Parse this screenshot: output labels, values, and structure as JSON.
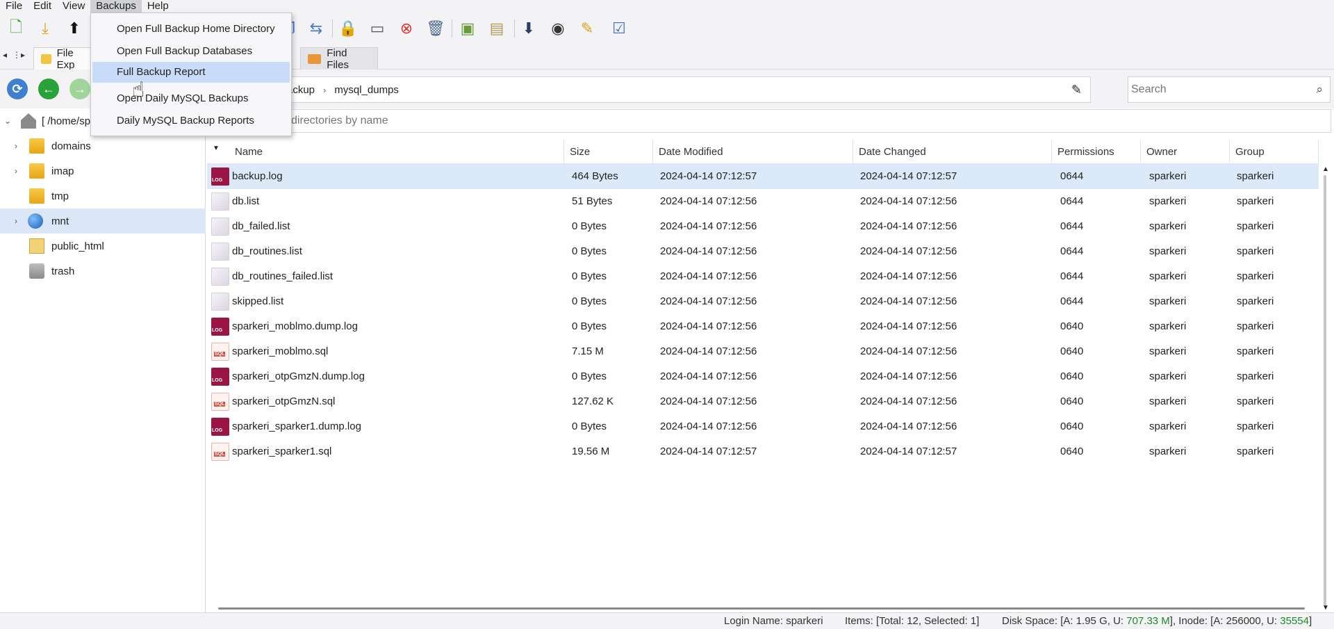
{
  "menubar": {
    "items": [
      "File",
      "Edit",
      "View",
      "Backups",
      "Help"
    ],
    "active": "Backups"
  },
  "tabs": [
    {
      "label": "File Exp",
      "icon": "folder-icon"
    },
    {
      "label": "Find Files",
      "icon": "find-files-icon"
    }
  ],
  "breadcrumb": {
    "first": "ackup",
    "second": "mysql_dumps"
  },
  "search": {
    "placeholder": "Search"
  },
  "filter": {
    "placeholder": "directories by name"
  },
  "tree": {
    "root_label": "[ /home/sp",
    "items": [
      {
        "label": "domains",
        "icon": "folder-icon",
        "expandable": true
      },
      {
        "label": "imap",
        "icon": "folder-icon",
        "expandable": true
      },
      {
        "label": "tmp",
        "icon": "folder-icon",
        "expandable": false
      },
      {
        "label": "mnt",
        "icon": "globe-icon",
        "expandable": true,
        "selected": true
      },
      {
        "label": "public_html",
        "icon": "web-file-icon",
        "expandable": false
      },
      {
        "label": "trash",
        "icon": "trash-icon",
        "expandable": false
      }
    ]
  },
  "table": {
    "columns": [
      "Name",
      "Size",
      "Date Modified",
      "Date Changed",
      "Permissions",
      "Owner",
      "Group"
    ],
    "rows": [
      {
        "type": "log",
        "name": "backup.log",
        "size": "464 Bytes",
        "modified": "2024-04-14 07:12:57",
        "changed": "2024-04-14 07:12:57",
        "perm": "0644",
        "owner": "sparkeri",
        "group": "sparkeri"
      },
      {
        "type": "txt",
        "name": "db.list",
        "size": "51 Bytes",
        "modified": "2024-04-14 07:12:56",
        "changed": "2024-04-14 07:12:56",
        "perm": "0644",
        "owner": "sparkeri",
        "group": "sparkeri"
      },
      {
        "type": "txt",
        "name": "db_failed.list",
        "size": "0 Bytes",
        "modified": "2024-04-14 07:12:56",
        "changed": "2024-04-14 07:12:56",
        "perm": "0644",
        "owner": "sparkeri",
        "group": "sparkeri"
      },
      {
        "type": "txt",
        "name": "db_routines.list",
        "size": "0 Bytes",
        "modified": "2024-04-14 07:12:56",
        "changed": "2024-04-14 07:12:56",
        "perm": "0644",
        "owner": "sparkeri",
        "group": "sparkeri"
      },
      {
        "type": "txt",
        "name": "db_routines_failed.list",
        "size": "0 Bytes",
        "modified": "2024-04-14 07:12:56",
        "changed": "2024-04-14 07:12:56",
        "perm": "0644",
        "owner": "sparkeri",
        "group": "sparkeri"
      },
      {
        "type": "txt",
        "name": "skipped.list",
        "size": "0 Bytes",
        "modified": "2024-04-14 07:12:56",
        "changed": "2024-04-14 07:12:56",
        "perm": "0644",
        "owner": "sparkeri",
        "group": "sparkeri"
      },
      {
        "type": "log",
        "name": "sparkeri_moblmo.dump.log",
        "size": "0 Bytes",
        "modified": "2024-04-14 07:12:56",
        "changed": "2024-04-14 07:12:56",
        "perm": "0640",
        "owner": "sparkeri",
        "group": "sparkeri"
      },
      {
        "type": "sql",
        "name": "sparkeri_moblmo.sql",
        "size": "7.15 M",
        "modified": "2024-04-14 07:12:56",
        "changed": "2024-04-14 07:12:56",
        "perm": "0640",
        "owner": "sparkeri",
        "group": "sparkeri"
      },
      {
        "type": "log",
        "name": "sparkeri_otpGmzN.dump.log",
        "size": "0 Bytes",
        "modified": "2024-04-14 07:12:56",
        "changed": "2024-04-14 07:12:56",
        "perm": "0640",
        "owner": "sparkeri",
        "group": "sparkeri"
      },
      {
        "type": "sql",
        "name": "sparkeri_otpGmzN.sql",
        "size": "127.62 K",
        "modified": "2024-04-14 07:12:56",
        "changed": "2024-04-14 07:12:56",
        "perm": "0640",
        "owner": "sparkeri",
        "group": "sparkeri"
      },
      {
        "type": "log",
        "name": "sparkeri_sparker1.dump.log",
        "size": "0 Bytes",
        "modified": "2024-04-14 07:12:56",
        "changed": "2024-04-14 07:12:56",
        "perm": "0640",
        "owner": "sparkeri",
        "group": "sparkeri"
      },
      {
        "type": "sql",
        "name": "sparkeri_sparker1.sql",
        "size": "19.56 M",
        "modified": "2024-04-14 07:12:57",
        "changed": "2024-04-14 07:12:57",
        "perm": "0640",
        "owner": "sparkeri",
        "group": "sparkeri"
      }
    ],
    "selected_row": 0
  },
  "dropdown": {
    "items": [
      "Open Full Backup Home Directory",
      "Open Full Backup Databases",
      "Full Backup Report",
      "Open Daily MySQL Backups",
      "Daily MySQL Backup Reports"
    ],
    "highlighted": 2
  },
  "status": {
    "login": "Login Name: sparkeri",
    "items": "Items: [Total: 12, Selected: 1]",
    "disk_prefix": "Disk Space: [A: 1.95 G, U: ",
    "disk_used": "707.33 M",
    "inode_prefix": "], Inode: [A: 256000, U: ",
    "inode_used": "35554",
    "suffix": "]"
  },
  "colors": {
    "accent_selection": "#dce9f8",
    "menu_highlight": "#c8dcf7",
    "status_green": "#1d8a2a",
    "log_icon": "#9a1444"
  }
}
